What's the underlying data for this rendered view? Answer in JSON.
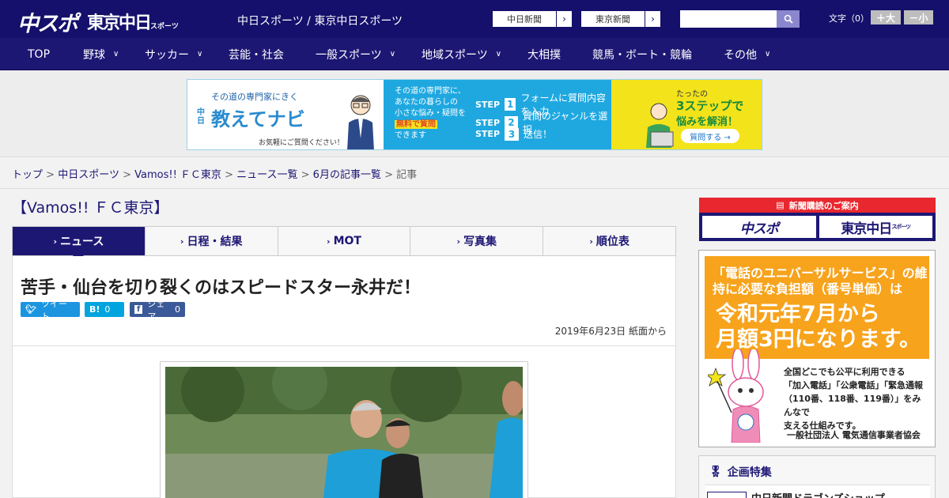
{
  "header": {
    "logo_chuspo": "中スポ",
    "logo_tokyo": "東京中日",
    "logo_tokyo_small": "スポーツ",
    "site_title": "中日スポーツ / 東京中日スポーツ",
    "link_chunichi": "中日新聞",
    "link_tokyo": "東京新聞",
    "search_placeholder": "",
    "fontsize_label": "文字（0）",
    "font_bigger": "＋大",
    "font_smaller": "－小"
  },
  "nav": {
    "items": [
      {
        "label": "TOP"
      },
      {
        "label": "野球"
      },
      {
        "label": "サッカー"
      },
      {
        "label": "芸能・社会"
      },
      {
        "label": "一般スポーツ"
      },
      {
        "label": "地域スポーツ"
      },
      {
        "label": "大相撲"
      },
      {
        "label": "競馬・ボート・競輪"
      },
      {
        "label": "その他"
      }
    ]
  },
  "banner": {
    "tagline": "その道の専門家にきく",
    "brand": "教えてナビ",
    "brand_prefix": "中日",
    "call": "お気軽にご質問ください！",
    "desc": "その道の専門家に、\nあなたの暮らしの\n小さな悩み・疑問を",
    "free": "無料で質問",
    "can": "できます",
    "step_word": "STEP",
    "steps": [
      {
        "num": "1",
        "text": "フォームに質問内容を入力"
      },
      {
        "num": "2",
        "text": "質問のジャンルを選択"
      },
      {
        "num": "3",
        "text": "送信！"
      }
    ],
    "only": "たったの",
    "three": "3ステップで",
    "solve": "悩みを解消！",
    "ask_button": "質問する →"
  },
  "breadcrumb": {
    "items": [
      "トップ",
      "中日スポーツ",
      "Vamos!! ＦＣ東京",
      "ニュース一覧",
      "6月の記事一覧"
    ],
    "separator": ">",
    "current": "記事"
  },
  "section": {
    "title": "【Vamos!! ＦＣ東京】"
  },
  "tabs": [
    {
      "label": "ニュース",
      "active": true
    },
    {
      "label": "日程・結果",
      "active": false
    },
    {
      "label": "MOT",
      "active": false
    },
    {
      "label": "写真集",
      "active": false
    },
    {
      "label": "順位表",
      "active": false
    }
  ],
  "article": {
    "headline": "苦手・仙台を切り裂くのはスピードスター永井だ！",
    "tweet_label": "ツイート",
    "hatena_label": "B!",
    "hatena_count": "0",
    "share_label": "シェア",
    "share_count": "0",
    "date": "2019年6月23日 紙面から"
  },
  "sidebar": {
    "subscribe_head": "新聞購読のご案内",
    "logo_chuspo": "中スポ",
    "logo_tokyo": "東京中日",
    "logo_tokyo_small": "スポーツ",
    "ad_title": "「電話のユニバーサルサービス」の維持に必要な負担額（番号単価）は",
    "ad_main_1": "令和元年7月から",
    "ad_main_2": "月額3円になります。",
    "ad_body_1": "全国どこでも公平に利用できる",
    "ad_body_2": "「加入電話」「公衆電話」「緊急通報",
    "ad_body_3": "（110番、118番、119番）」をみんなで",
    "ad_body_4": "支える仕組みです。",
    "ad_org": "一般社団法人 電気通信事業者協会",
    "feature_title": "企画特集",
    "feature_item": "中日新聞ドラゴンズショップ"
  },
  "colors": {
    "brand_navy": "#14106b",
    "nav_navy": "#1d1774",
    "accent_red": "#e8272e",
    "ad_orange": "#f7a31c"
  }
}
